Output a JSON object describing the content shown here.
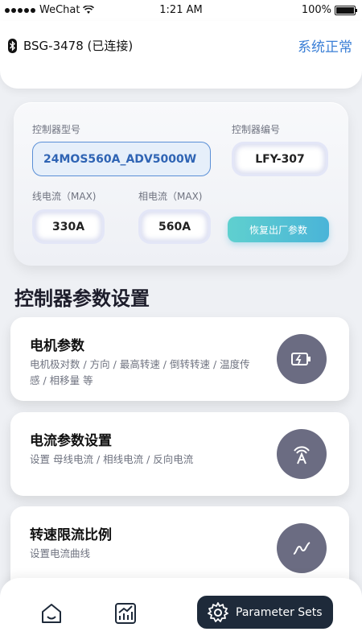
{
  "status_bar": {
    "carrier": "WeChat",
    "time": "1:21 AM",
    "battery": "100%",
    "battery_level": 1.0
  },
  "header": {
    "device_name": "BSG-3478 (已连接)",
    "system_status": "系统正常",
    "status_color": "#3b7fd6"
  },
  "controller": {
    "model_label": "控制器型号",
    "model_value": "24MOS560A_ADV5000W",
    "serial_label": "控制器编号",
    "serial_value": "LFY-307",
    "line_current_label": "线电流（MAX)",
    "line_current_value": "330A",
    "phase_current_label": "相电流（MAX)",
    "phase_current_value": "560A",
    "reset_button": "恢复出厂参数"
  },
  "section_title": "控制器参数设置",
  "cards": [
    {
      "title": "电机参数",
      "desc": "电机极对数 / 方向 / 最高转速 / 倒转转速 / 温度传感 / 相移量 等",
      "icon": "battery-charge-icon"
    },
    {
      "title": "电流参数设置",
      "desc": "设置 母线电流 / 相线电流 / 反向电流",
      "icon": "ampere-icon"
    },
    {
      "title": "转速限流比例",
      "desc": "设置电流曲线",
      "icon": "curve-icon"
    }
  ],
  "nav": {
    "home_icon": "home-icon",
    "stats_icon": "chart-icon",
    "active_label": "Parameter Sets",
    "active_icon": "gear-icon"
  },
  "colors": {
    "accent": "#3b7fd6",
    "reset_gradient": [
      "#5fd0cf",
      "#4ab4d8"
    ],
    "icon_bg": "#6b6c82",
    "nav_active_bg": "#1e2a3a"
  }
}
